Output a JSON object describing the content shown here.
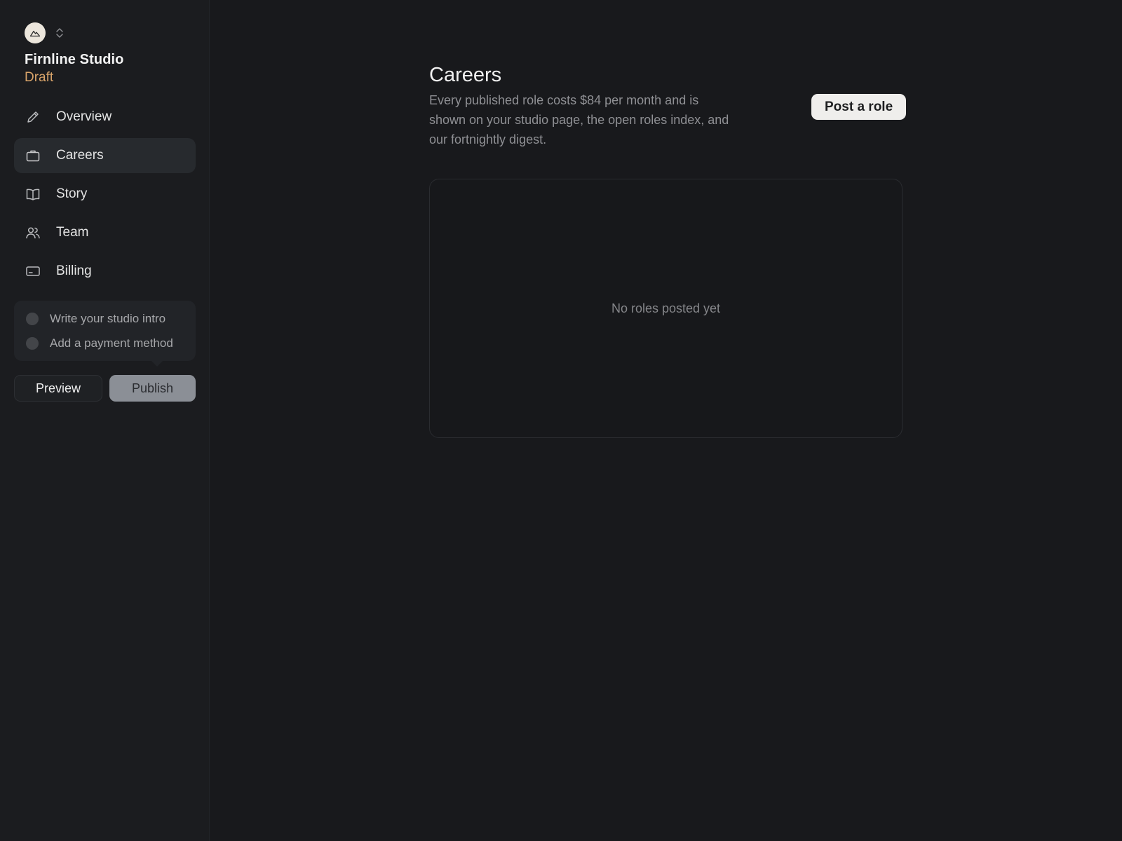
{
  "studio": {
    "name": "Firnline Studio",
    "status": "Draft",
    "status_color": "#d9a46a"
  },
  "sidebar": {
    "items": [
      {
        "label": "Overview",
        "icon": "pencil-icon",
        "active": false
      },
      {
        "label": "Careers",
        "icon": "briefcase-icon",
        "active": true
      },
      {
        "label": "Story",
        "icon": "book-icon",
        "active": false
      },
      {
        "label": "Team",
        "icon": "users-icon",
        "active": false
      },
      {
        "label": "Billing",
        "icon": "card-icon",
        "active": false
      }
    ]
  },
  "checklist": {
    "items": [
      {
        "label": "Write your studio intro",
        "done": false
      },
      {
        "label": "Add a payment method",
        "done": false
      }
    ]
  },
  "actions": {
    "preview_label": "Preview",
    "publish_label": "Publish"
  },
  "main": {
    "title": "Careers",
    "description": "Every published role costs $84 per month and is shown on your studio page, the open roles index, and our fortnightly digest.",
    "post_button_label": "Post a role",
    "empty_text": "No roles posted yet"
  }
}
